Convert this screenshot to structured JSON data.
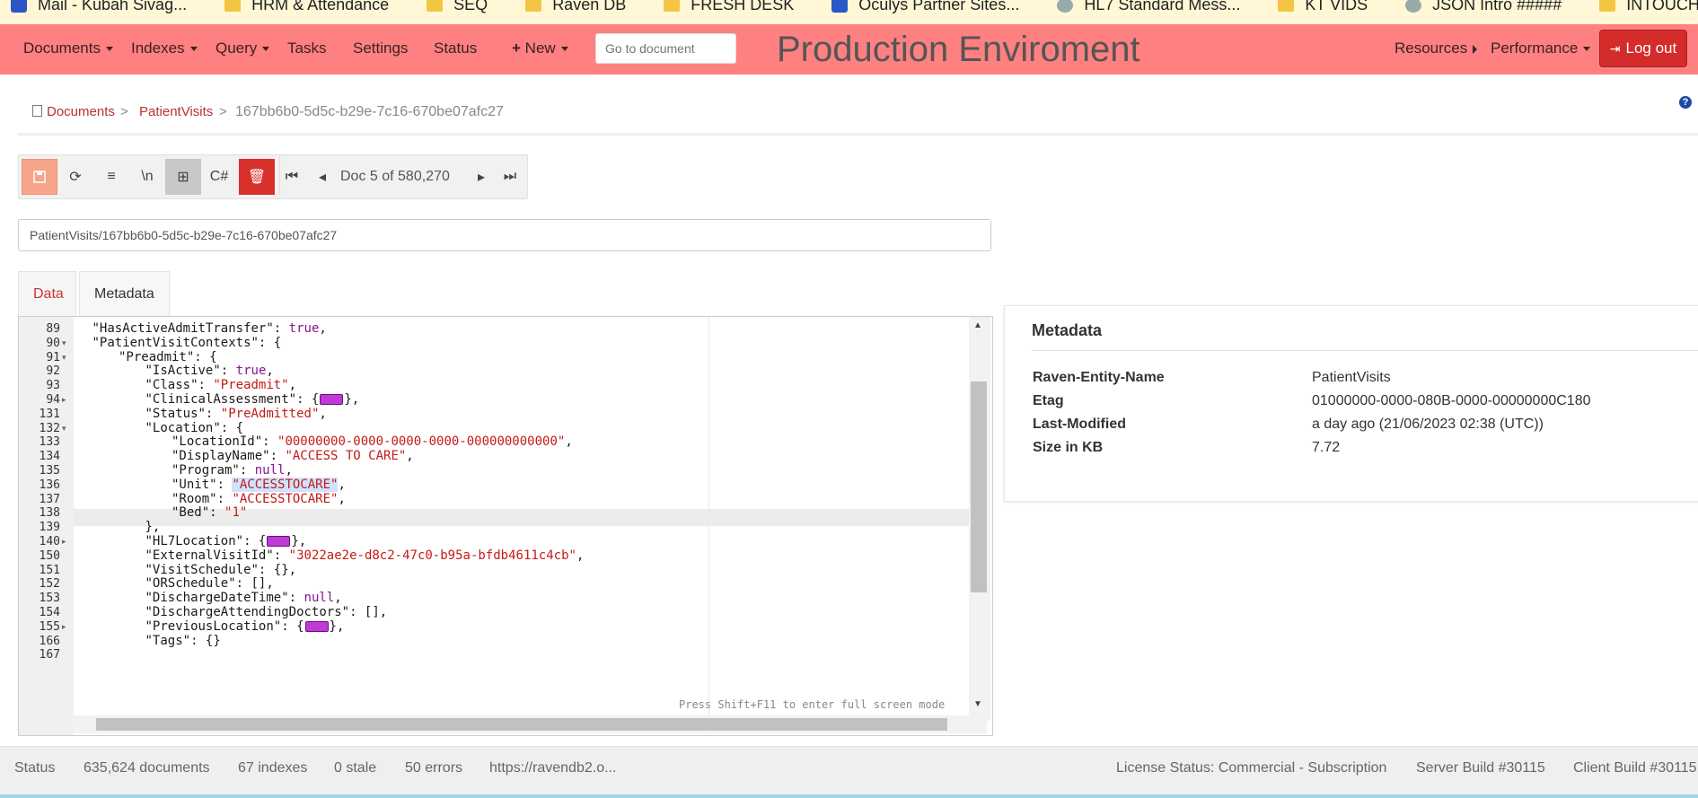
{
  "bookmarks": [
    {
      "label": "Mail - Kubah Sivag...",
      "icon": "mail-icon"
    },
    {
      "label": "HRM & Attendance",
      "icon": "folder-icon"
    },
    {
      "label": "SEQ",
      "icon": "folder-icon"
    },
    {
      "label": "Raven DB",
      "icon": "folder-icon"
    },
    {
      "label": "FRESH DESK",
      "icon": "folder-icon"
    },
    {
      "label": "Oculys Partner Sites...",
      "icon": "sharepoint-icon"
    },
    {
      "label": "HL7 Standard Mess...",
      "icon": "wrench-icon"
    },
    {
      "label": "KT VIDS",
      "icon": "folder-icon"
    },
    {
      "label": "JSON Intro #####",
      "icon": "globe-icon"
    },
    {
      "label": "INTOUCH OZ",
      "icon": "folder-icon"
    }
  ],
  "nav": {
    "documents": "Documents",
    "indexes": "Indexes",
    "query": "Query",
    "tasks": "Tasks",
    "settings": "Settings",
    "status": "Status",
    "new": "New",
    "goto_placeholder": "Go to document",
    "env_title": "Production Enviroment",
    "resources": "Resources",
    "performance": "Performance",
    "logout": "Log out"
  },
  "breadcrumb": {
    "documents": "Documents",
    "sep": ">",
    "collection": "PatientVisits",
    "doc_id": "167bb6b0-5d5c-b29e-7c16-670be07afc27"
  },
  "toolbar": {
    "newline": "\\n",
    "csharp": "C#",
    "doc_position": "Doc 5 of 580,270"
  },
  "doc_id_field": "PatientVisits/167bb6b0-5d5c-b29e-7c16-670be07afc27",
  "tabs": {
    "data": "Data",
    "metadata": "Metadata"
  },
  "editor": {
    "fullscreen_hint": "Press Shift+F11 to enter full screen mode",
    "lines": [
      {
        "n": "89",
        "fold": "",
        "indent": 1,
        "parts": [
          [
            "k",
            "\"HasActiveAdmitTransfer\": "
          ],
          [
            "b",
            "true"
          ],
          [
            "k",
            ","
          ]
        ]
      },
      {
        "n": "90",
        "fold": "▾",
        "indent": 1,
        "parts": [
          [
            "k",
            "\"PatientVisitContexts\": {"
          ]
        ]
      },
      {
        "n": "91",
        "fold": "▾",
        "indent": 2,
        "parts": [
          [
            "k",
            "\"Preadmit\": {"
          ]
        ]
      },
      {
        "n": "92",
        "fold": "",
        "indent": 3,
        "parts": [
          [
            "k",
            "\"IsActive\": "
          ],
          [
            "b",
            "true"
          ],
          [
            "k",
            ","
          ]
        ]
      },
      {
        "n": "93",
        "fold": "",
        "indent": 3,
        "parts": [
          [
            "k",
            "\"Class\": "
          ],
          [
            "s",
            "\"Preadmit\""
          ],
          [
            "k",
            ","
          ]
        ]
      },
      {
        "n": "94",
        "fold": "▸",
        "indent": 3,
        "parts": [
          [
            "k",
            "\"ClinicalAssessment\": {"
          ],
          [
            "chip",
            ""
          ],
          [
            "k",
            "},"
          ]
        ]
      },
      {
        "n": "131",
        "fold": "",
        "indent": 3,
        "parts": [
          [
            "k",
            "\"Status\": "
          ],
          [
            "s",
            "\"PreAdmitted\""
          ],
          [
            "k",
            ","
          ]
        ]
      },
      {
        "n": "132",
        "fold": "▾",
        "indent": 3,
        "parts": [
          [
            "k",
            "\"Location\": {"
          ]
        ]
      },
      {
        "n": "133",
        "fold": "",
        "indent": 4,
        "parts": [
          [
            "k",
            "\"LocationId\": "
          ],
          [
            "s",
            "\"00000000-0000-0000-0000-000000000000\""
          ],
          [
            "k",
            ","
          ]
        ]
      },
      {
        "n": "134",
        "fold": "",
        "indent": 4,
        "parts": [
          [
            "k",
            "\"DisplayName\": "
          ],
          [
            "s",
            "\"ACCESS TO CARE\""
          ],
          [
            "k",
            ","
          ]
        ]
      },
      {
        "n": "135",
        "fold": "",
        "indent": 4,
        "parts": [
          [
            "k",
            "\"Program\": "
          ],
          [
            "n",
            "null"
          ],
          [
            "k",
            ","
          ]
        ]
      },
      {
        "n": "136",
        "fold": "",
        "indent": 4,
        "parts": [
          [
            "k",
            "\"Unit\": "
          ],
          [
            "s",
            "\"ACCESSTOCARE\""
          ],
          [
            "k",
            ","
          ]
        ]
      },
      {
        "n": "137",
        "fold": "",
        "indent": 4,
        "parts": [
          [
            "k",
            "\"Room\": "
          ],
          [
            "s",
            "\"ACCESSTOCARE\""
          ],
          [
            "k",
            ","
          ]
        ]
      },
      {
        "n": "138",
        "fold": "",
        "indent": 4,
        "parts": [
          [
            "k",
            "\"Bed\": "
          ],
          [
            "s",
            "\"1\""
          ]
        ]
      },
      {
        "n": "139",
        "fold": "",
        "indent": 3,
        "parts": [
          [
            "k",
            "},"
          ]
        ]
      },
      {
        "n": "140",
        "fold": "▸",
        "indent": 3,
        "parts": [
          [
            "k",
            "\"HL7Location\": {"
          ],
          [
            "chip",
            ""
          ],
          [
            "k",
            "},"
          ]
        ]
      },
      {
        "n": "150",
        "fold": "",
        "indent": 3,
        "parts": [
          [
            "k",
            "\"ExternalVisitId\": "
          ],
          [
            "s",
            "\"3022ae2e-d8c2-47c0-b95a-bfdb4611c4cb\""
          ],
          [
            "k",
            ","
          ]
        ]
      },
      {
        "n": "151",
        "fold": "",
        "indent": 3,
        "parts": [
          [
            "k",
            "\"VisitSchedule\": {},"
          ]
        ]
      },
      {
        "n": "152",
        "fold": "",
        "indent": 3,
        "parts": [
          [
            "k",
            "\"ORSchedule\": [],"
          ]
        ]
      },
      {
        "n": "153",
        "fold": "",
        "indent": 3,
        "parts": [
          [
            "k",
            "\"DischargeDateTime\": "
          ],
          [
            "n",
            "null"
          ],
          [
            "k",
            ","
          ]
        ]
      },
      {
        "n": "154",
        "fold": "",
        "indent": 3,
        "parts": [
          [
            "k",
            "\"DischargeAttendingDoctors\": [],"
          ]
        ]
      },
      {
        "n": "155",
        "fold": "▸",
        "indent": 3,
        "parts": [
          [
            "k",
            "\"PreviousLocation\": {"
          ],
          [
            "chip",
            ""
          ],
          [
            "k",
            "},"
          ]
        ]
      },
      {
        "n": "166",
        "fold": "",
        "indent": 3,
        "parts": [
          [
            "k",
            "\"Tags\": {}"
          ]
        ]
      },
      {
        "n": "167",
        "fold": "",
        "indent": 2,
        "parts": [
          [
            "k",
            ""
          ]
        ]
      }
    ],
    "highlighted_line": "136"
  },
  "metadata": {
    "title": "Metadata",
    "rows": [
      {
        "key": "Raven-Entity-Name",
        "value": "PatientVisits"
      },
      {
        "key": "Etag",
        "value": "01000000-0000-080B-0000-00000000C180"
      },
      {
        "key": "Last-Modified",
        "value": "a day ago (21/06/2023 02:38 (UTC))"
      },
      {
        "key": "Size in KB",
        "value": "7.72"
      }
    ]
  },
  "statusbar": {
    "status": "Status",
    "documents": "635,624 documents",
    "indexes": "67 indexes",
    "stale": "0 stale",
    "errors": "50 errors",
    "url": "https://ravendb2.o...",
    "license": "License Status: Commercial - Subscription",
    "server_build": "Server Build #30115",
    "client_build": "Client Build #30115"
  },
  "colors": {
    "navbar": "#ff8081",
    "logout": "#d42b2b",
    "accent": "#b8322e",
    "string": "#c41a16",
    "keyword": "#881391"
  }
}
